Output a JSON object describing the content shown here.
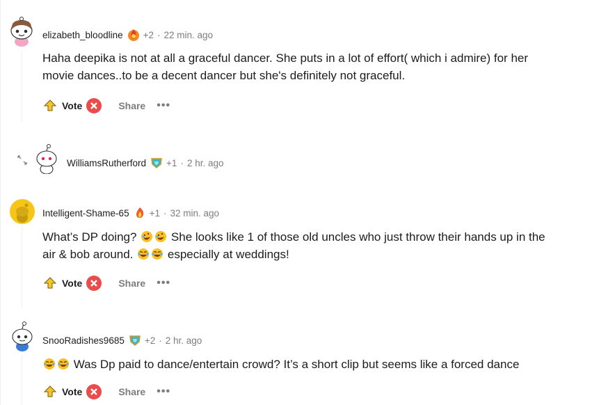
{
  "comments": [
    {
      "username": "elizabeth_bloodline",
      "karma": "+2",
      "separator": "·",
      "time": "22 min. ago",
      "body_line1": "Haha deepika is not at all a graceful dancer. She puts in a lot of effort( which i admire) for her",
      "body_line2": "movie dances..to be a decent dancer but she's definitely not graceful.",
      "vote_label": "Vote",
      "share_label": "Share",
      "more_label": "•••"
    },
    {
      "username": "WilliamsRutherford",
      "karma": "+1",
      "separator": "·",
      "time": "2 hr. ago"
    },
    {
      "username": "Intelligent-Shame-65",
      "karma": "+1",
      "separator": "·",
      "time": "32 min. ago",
      "body_line1": "What’s DP doing?",
      "body_line1b": "She looks like 1 of those old uncles who just throw their hands up in the",
      "body_line2": "air & bob around.",
      "body_line2b": "especially at weddings!",
      "vote_label": "Vote",
      "share_label": "Share",
      "more_label": "•••"
    },
    {
      "username": "SnooRadishes9685",
      "karma": "+2",
      "separator": "·",
      "time": "2 hr. ago",
      "body_line1": "Was Dp paid to dance/entertain crowd? It’s a short clip but seems like a forced dance",
      "vote_label": "Vote",
      "share_label": "Share",
      "more_label": "•••"
    }
  ],
  "colors": {
    "downvote": "#ea4b4b",
    "upvote": "#f4c430",
    "meta_gray": "#7c7c7c"
  }
}
